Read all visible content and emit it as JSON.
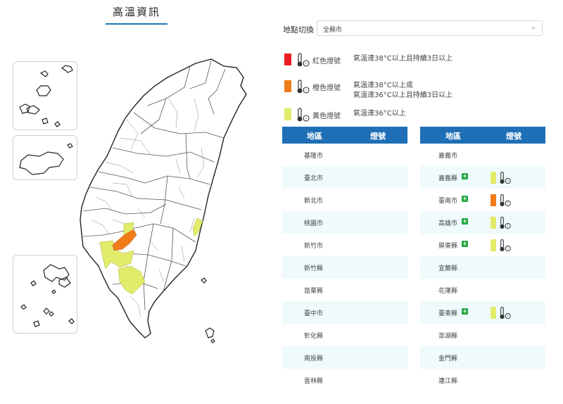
{
  "page": {
    "title": "高溫資訊"
  },
  "location": {
    "label": "地點切換",
    "selected": "全縣市"
  },
  "colors": {
    "red": "#ee1c25",
    "orange": "#f07d1a",
    "yellow": "#e2eb6a",
    "header_blue": "#1f6fb6",
    "row_alt": "#eefafc"
  },
  "legend": [
    {
      "key": "red",
      "name": "紅色燈號",
      "desc": [
        "氣溫達38°C以上且持續3日以上"
      ],
      "icon": "thermometer-icon"
    },
    {
      "key": "orange",
      "name": "橙色燈號",
      "desc": [
        "氣溫達38°C以上或",
        "氣溫達36°C以上且持續3日以上"
      ],
      "icon": "thermometer-icon"
    },
    {
      "key": "yellow",
      "name": "黃色燈號",
      "desc": [
        "氣溫達36°C以上"
      ],
      "icon": "thermometer-icon"
    }
  ],
  "table": {
    "col_area": "地區",
    "col_signal": "燈號",
    "left": [
      {
        "area": "基隆市",
        "signal": null
      },
      {
        "area": "臺北市",
        "signal": null
      },
      {
        "area": "新北市",
        "signal": null
      },
      {
        "area": "桃園市",
        "signal": null
      },
      {
        "area": "新竹市",
        "signal": null
      },
      {
        "area": "新竹縣",
        "signal": null
      },
      {
        "area": "苗栗縣",
        "signal": null
      },
      {
        "area": "臺中市",
        "signal": null
      },
      {
        "area": "彰化縣",
        "signal": null
      },
      {
        "area": "南投縣",
        "signal": null
      },
      {
        "area": "雲林縣",
        "signal": null
      }
    ],
    "right": [
      {
        "area": "嘉義市",
        "signal": null
      },
      {
        "area": "嘉義縣",
        "signal": "yellow"
      },
      {
        "area": "臺南市",
        "signal": "orange"
      },
      {
        "area": "高雄市",
        "signal": "yellow"
      },
      {
        "area": "屏東縣",
        "signal": "yellow"
      },
      {
        "area": "宜蘭縣",
        "signal": null
      },
      {
        "area": "花蓮縣",
        "signal": null
      },
      {
        "area": "臺東縣",
        "signal": "yellow"
      },
      {
        "area": "澎湖縣",
        "signal": null
      },
      {
        "area": "金門縣",
        "signal": null
      },
      {
        "area": "連江縣",
        "signal": null
      }
    ]
  }
}
